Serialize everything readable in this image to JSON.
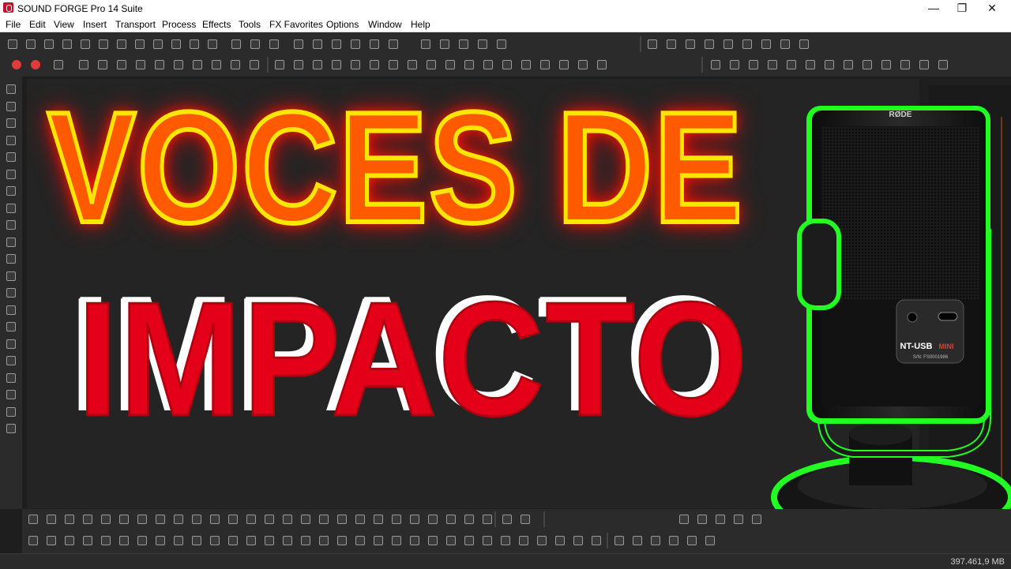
{
  "window": {
    "title": "SOUND FORGE Pro 14 Suite",
    "controls": {
      "minimize": "—",
      "restore": "❐",
      "close": "✕"
    }
  },
  "menu": [
    "File",
    "Edit",
    "View",
    "Insert",
    "Transport",
    "Process",
    "Effects",
    "Tools",
    "FX Favorites",
    "Options",
    "Window",
    "Help"
  ],
  "thumbnail": {
    "line1": "VOCES DE",
    "line2": "IMPACTO",
    "colors": {
      "line1_fill": "#ff5a00",
      "line1_outline": "#ffe600",
      "line2_fill": "#e5001a",
      "line2_shadow": "#ffffff",
      "mic_glow": "#22ff22"
    }
  },
  "microphone": {
    "top_brand": "RØDE",
    "model_label": "NT-USB",
    "model_suffix": "MINI",
    "serial": "S/N: FS0001986"
  },
  "status": {
    "memory": "397.461,9 MB"
  },
  "icons": {
    "transport": [
      "record-arm-icon",
      "record-icon",
      "loop-icon",
      "play-icon",
      "play-all-icon",
      "pause-icon",
      "stop-icon",
      "go-to-start-icon",
      "rewind-icon",
      "fast-rewind-icon",
      "fast-forward-icon",
      "go-to-end-icon"
    ]
  }
}
